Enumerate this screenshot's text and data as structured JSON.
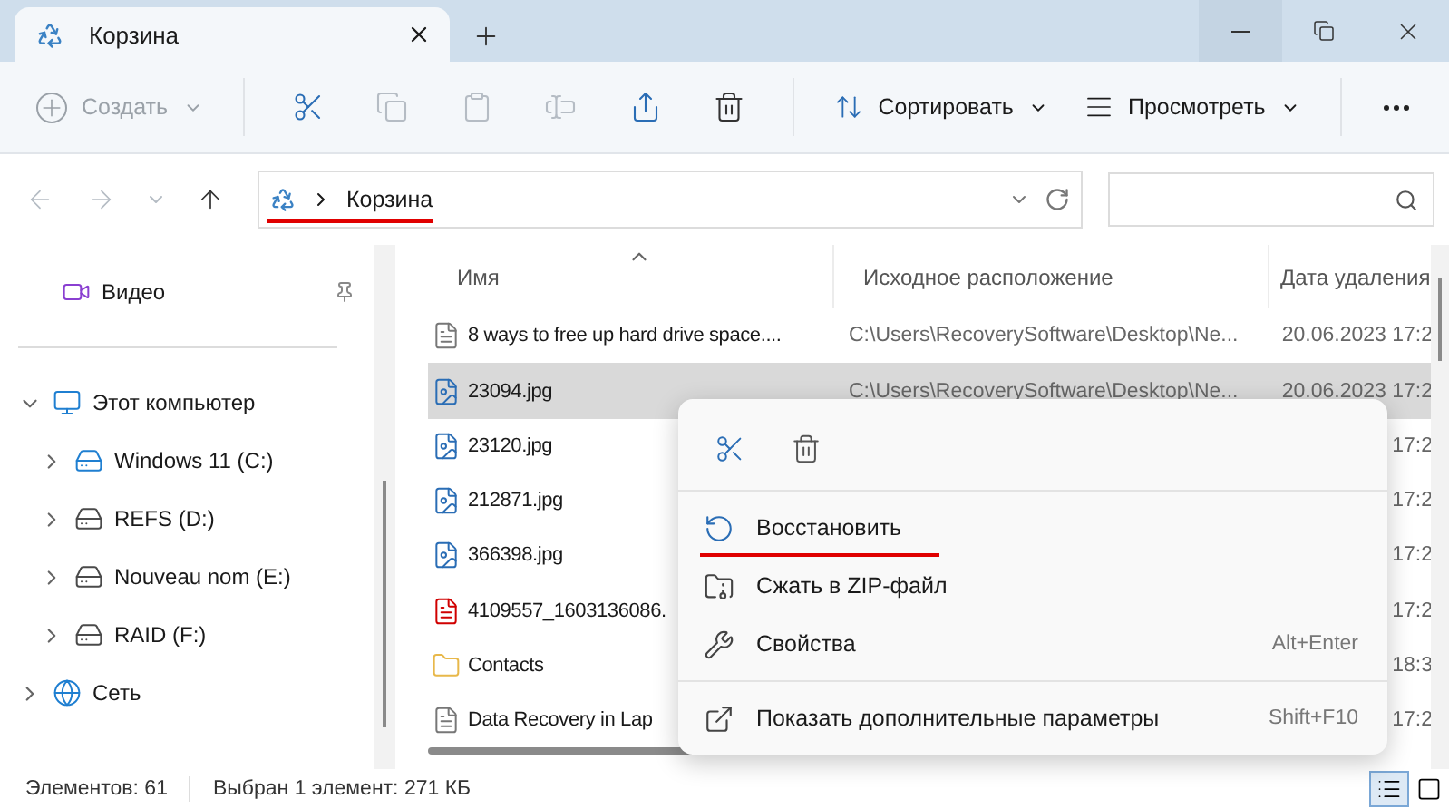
{
  "window": {
    "tab": {
      "title": "Корзина"
    }
  },
  "toolbar": {
    "create": {
      "label": "Создать",
      "disabled": true
    },
    "tools": [
      {
        "kind": "cut",
        "disabled": false
      },
      {
        "kind": "copy",
        "disabled": true
      },
      {
        "kind": "paste",
        "disabled": true
      },
      {
        "kind": "rename",
        "disabled": true
      },
      {
        "kind": "share",
        "disabled": false
      },
      {
        "kind": "delete",
        "disabled": false
      }
    ],
    "sort": {
      "label": "Сортировать"
    },
    "view": {
      "label": "Просмотреть"
    }
  },
  "address": {
    "crumbs": [
      {
        "label": "Корзина",
        "underlined": true
      }
    ]
  },
  "sidebar": {
    "pinned": [
      {
        "label": "Видео",
        "kind": "video"
      }
    ],
    "tree": [
      {
        "label": "Этот компьютер",
        "kind": "computer",
        "expanded": true,
        "children": [
          {
            "label": "Windows 11 (C:)",
            "kind": "system-drive",
            "expanded": false
          },
          {
            "label": "REFS (D:)",
            "kind": "drive",
            "expanded": false
          },
          {
            "label": "Nouveau nom (E:)",
            "kind": "drive",
            "expanded": false
          },
          {
            "label": "RAID (F:)",
            "kind": "drive",
            "expanded": false
          }
        ]
      },
      {
        "label": "Сеть",
        "kind": "network",
        "expanded": false
      }
    ]
  },
  "table": {
    "columns": [
      {
        "label": "Имя",
        "sorted": true
      },
      {
        "label": "Исходное расположение",
        "sorted": false
      },
      {
        "label": "Дата удаления",
        "sorted": false
      }
    ],
    "rows": [
      {
        "kind": "text",
        "name": "8 ways to free up hard drive space....",
        "location": "C:\\Users\\RecoverySoftware\\Desktop\\Ne...",
        "date": "20.06.2023 17:2",
        "selected": false
      },
      {
        "kind": "image",
        "name": "23094.jpg",
        "location": "C:\\Users\\RecoverySoftware\\Desktop\\Ne...",
        "date": "20.06.2023 17:2",
        "selected": true
      },
      {
        "kind": "image",
        "name": "23120.jpg",
        "date": "17:2",
        "selected": false
      },
      {
        "kind": "image",
        "name": "212871.jpg",
        "date": "17:2",
        "selected": false
      },
      {
        "kind": "image",
        "name": "366398.jpg",
        "date": "17:2",
        "selected": false
      },
      {
        "kind": "pdf",
        "name": "4109557_1603136086.",
        "date": "17:2",
        "selected": false
      },
      {
        "kind": "folder",
        "name": "Contacts",
        "date": "18:3",
        "selected": false
      },
      {
        "kind": "text",
        "name": "Data Recovery in Lap",
        "date": "17:2",
        "selected": false
      }
    ]
  },
  "context_menu": {
    "actions": [
      {
        "kind": "cut"
      },
      {
        "kind": "delete"
      }
    ],
    "sections": [
      [
        {
          "kind": "restore",
          "label": "Восстановить",
          "underlined": true
        },
        {
          "kind": "zip",
          "label": "Сжать в ZIP-файл"
        },
        {
          "kind": "properties",
          "label": "Свойства",
          "shortcut": "Alt+Enter"
        }
      ],
      [
        {
          "kind": "more",
          "label": "Показать дополнительные параметры",
          "shortcut": "Shift+F10"
        }
      ]
    ]
  },
  "status_bar": {
    "count": "Элементов: 61",
    "selection": "Выбран 1 элемент: 271 КБ",
    "views": [
      {
        "kind": "details",
        "selected": true
      },
      {
        "kind": "tiles",
        "selected": false
      }
    ]
  }
}
